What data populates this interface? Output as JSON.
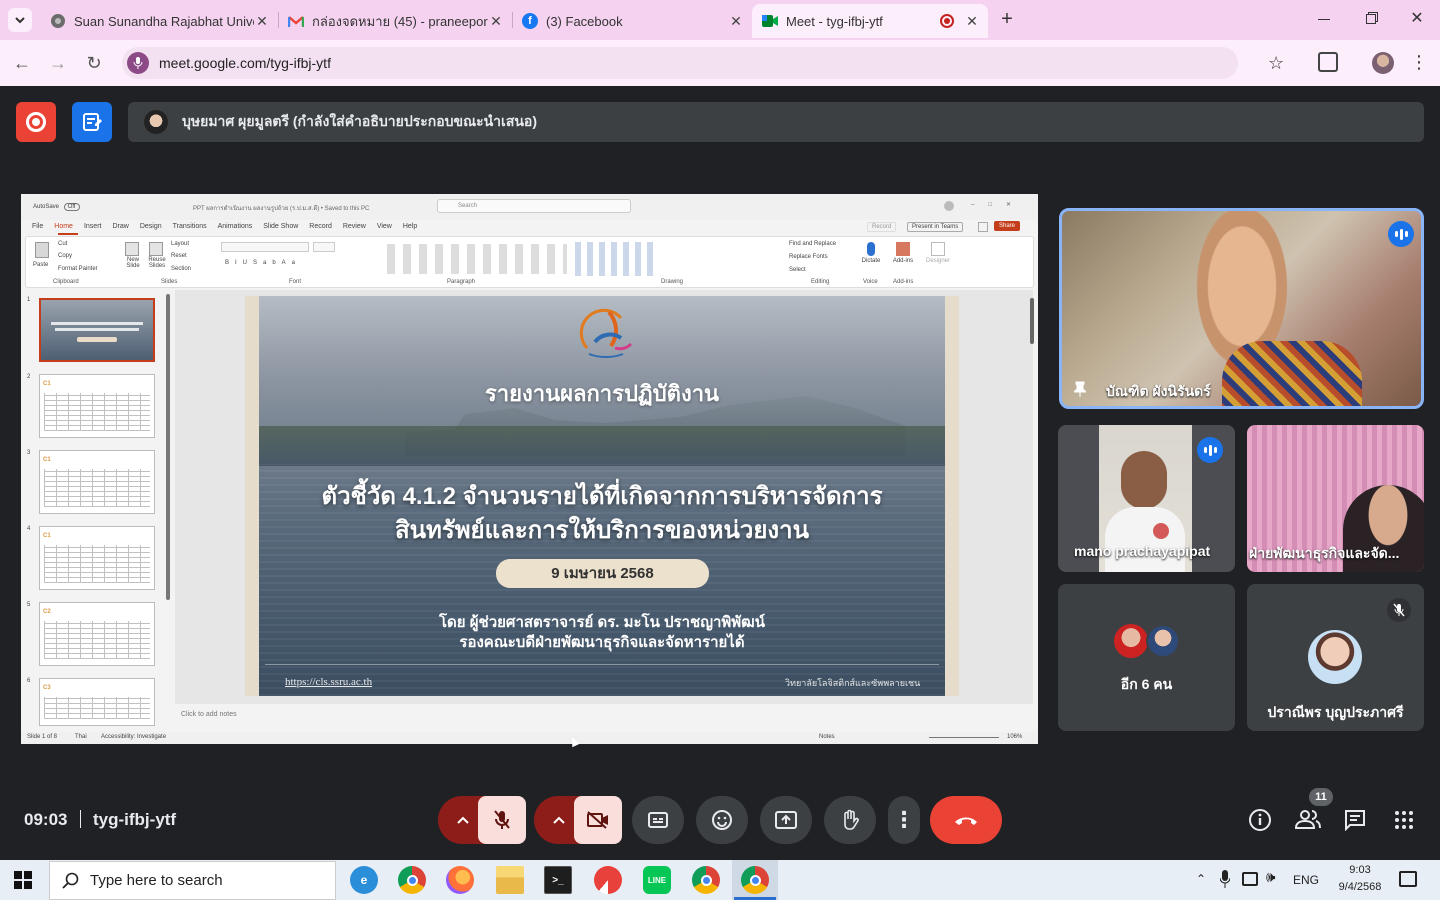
{
  "tabs": [
    {
      "title": "Suan Sunandha Rajabhat Unive",
      "icon": "ssru-favicon"
    },
    {
      "title": "กล่องจดหมาย (45) - praneeporn.b",
      "icon": "gmail-icon"
    },
    {
      "title": "(3) Facebook",
      "icon": "facebook-icon"
    },
    {
      "title": "Meet - tyg-ifbj-ytf",
      "icon": "meet-icon"
    }
  ],
  "address": {
    "url": "meet.google.com/tyg-ifbj-ytf"
  },
  "banner": {
    "text": "บุษยมาศ ผุยมูลตรี (กำลังใส่คำอธิบายประกอบขณะนำเสนอ)"
  },
  "ppt": {
    "title_bar": "PPT ผลการดำเนินงาน ผลงานรูปถ้วย (ร.ป.ม.ส.ดี) • Saved to this PC",
    "autosave": "AutoSave",
    "autosave_state": "Off",
    "search": "Search",
    "menu": [
      "File",
      "Home",
      "Insert",
      "Draw",
      "Design",
      "Transitions",
      "Animations",
      "Slide Show",
      "Record",
      "Review",
      "View",
      "Help"
    ],
    "record_btn": "Record",
    "teams_btn": "Present in Teams",
    "share_btn": "Share",
    "groups": [
      "Clipboard",
      "Slides",
      "Font",
      "Paragraph",
      "Drawing",
      "Editing",
      "Voice",
      "Add-ins"
    ],
    "clipboard": [
      "Cut",
      "Copy",
      "Format Painter",
      "Paste"
    ],
    "slides_cmds": [
      "New Slide",
      "Reuse Slides",
      "Layout",
      "Reset",
      "Section"
    ],
    "editing": [
      "Find and Replace",
      "Replace Fonts",
      "Select"
    ],
    "voice": "Dictate",
    "addins": "Add-ins",
    "designer": "Designer",
    "thumb_numbers": [
      "1",
      "2",
      "3",
      "4",
      "5",
      "6"
    ],
    "thumb_tags": [
      "C1",
      "C1",
      "C1",
      "C2",
      "C3"
    ],
    "notes_placeholder": "Click to add notes",
    "status": {
      "slide": "Slide 1 of 8",
      "lang": "Thai",
      "access": "Accessibility: Investigate",
      "notes": "Notes",
      "zoom": "106%"
    }
  },
  "slide": {
    "heading": "รายงานผลการปฏิบัติงาน",
    "title_line1": "ตัวชี้วัด 4.1.2 จำนวนรายได้ที่เกิดจากการบริหารจัดการ",
    "title_line2": "สินทรัพย์และการให้บริการของหน่วยงาน",
    "date": "9 เมษายน 2568",
    "presenter1": "โดย ผู้ช่วยศาสตราจารย์ ดร. มะโน ปราชญาพิพัฒน์",
    "presenter2": "รองคณะบดีฝ่ายพัฒนาธุรกิจและจัดหารายได้",
    "url": "https://cls.ssru.ac.th",
    "college": "วิทยาลัยโลจิสติกส์และซัพพลายเชน"
  },
  "participants": [
    {
      "name": "บัณฑิต ผังนิรันดร์",
      "speaking": true,
      "pinned": true
    },
    {
      "name": "mano prachayapipat",
      "speaking": true
    },
    {
      "name": "ฝ่ายพัฒนาธุรกิจและจัด..."
    },
    {
      "name": "อีก 6 คน"
    },
    {
      "name": "ปราณีพร บุญประภาศรี",
      "muted": true
    }
  ],
  "meeting": {
    "time": "09:03",
    "code": "tyg-ifbj-ytf",
    "people_count": "11"
  },
  "taskbar": {
    "search_placeholder": "Type here to search",
    "lang": "ENG",
    "time": "9:03",
    "date": "9/4/2568"
  },
  "colors": {
    "tabstrip": "#f5d3f0",
    "meet_bg": "#202124",
    "tile": "#3c4043",
    "end_call": "#ea4335",
    "muted_ctrl": "#f9dedc",
    "speaking_border": "#8ab4f8"
  }
}
